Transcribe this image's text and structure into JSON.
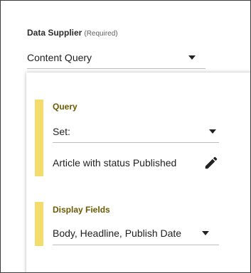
{
  "data_supplier": {
    "label": "Data Supplier",
    "required_note": "(Required)",
    "selected": "Content Query",
    "caret_icon": "chevron-down-icon"
  },
  "query_section": {
    "title": "Query",
    "set_select": {
      "selected": "Set:"
    },
    "filter_summary": "Article with status Published",
    "edit_icon": "pencil-icon"
  },
  "display_fields_section": {
    "title": "Display Fields",
    "selected": "Body, Headline, Publish Date"
  },
  "colors": {
    "accent_bar": "#f3dc6b",
    "section_title": "#6d5a00",
    "border": "#bdbdbd"
  }
}
